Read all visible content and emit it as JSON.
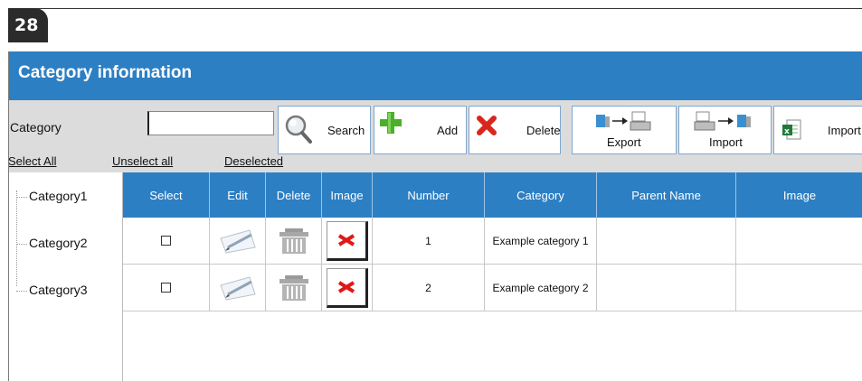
{
  "page_badge": "28",
  "window": {
    "title": "Category information"
  },
  "toolbar": {
    "category_label": "Category",
    "category_value": "",
    "search_label": "Search",
    "add_label": "Add",
    "delete_label": "Delete",
    "export_label": "Export",
    "import_label": "Import",
    "import_excel_label": "Import"
  },
  "links": {
    "select_all": "Select All",
    "unselect_all": "Unselect all",
    "deselected": "Deselected"
  },
  "tree": {
    "items": [
      "Category1",
      "Category2",
      "Category3"
    ]
  },
  "grid": {
    "columns": [
      "Select",
      "Edit",
      "Delete",
      "Image",
      "Number",
      "Category",
      "Parent Name",
      "Image"
    ],
    "rows": [
      {
        "number": "1",
        "category": "Example category 1",
        "parent_name": ""
      },
      {
        "number": "2",
        "category": "Example category 2",
        "parent_name": ""
      }
    ]
  },
  "colors": {
    "accent": "#2d7fc3",
    "toolbar_bg": "#dcdcdc",
    "add_green": "#4caf2a",
    "delete_red": "#d9261c"
  }
}
